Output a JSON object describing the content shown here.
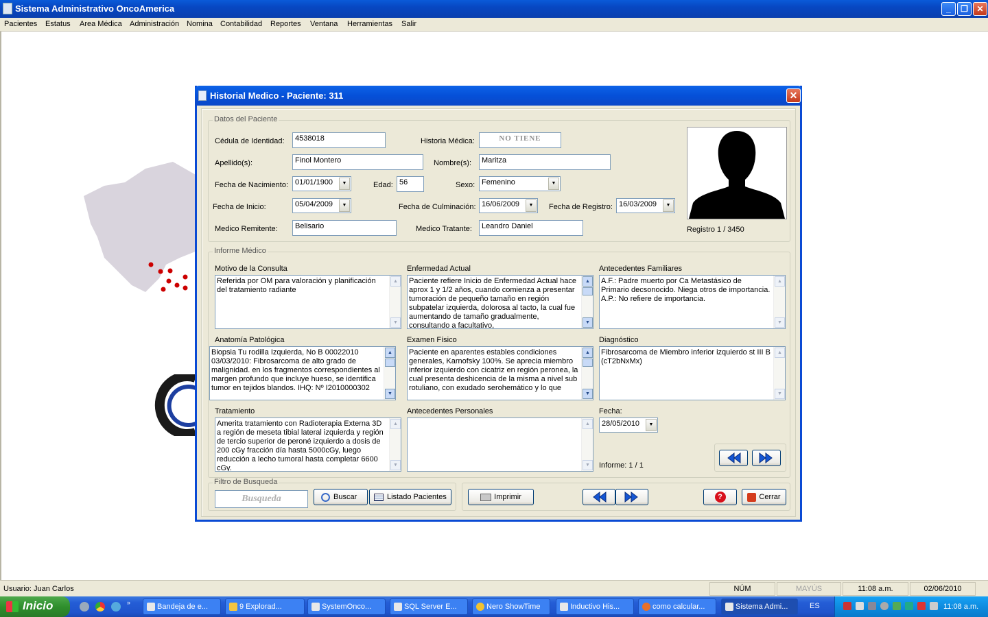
{
  "app": {
    "title": "Sistema Administrativo OncoAmerica"
  },
  "menu": [
    "Pacientes",
    "Estatus",
    "Area Médica",
    "Administración",
    "Nomina",
    "Contabilidad",
    "Reportes",
    "Ventana",
    "Herramientas",
    "Salir"
  ],
  "dialog": {
    "title": "Historial Medico - Paciente: 311",
    "datos": {
      "group_title": "Datos del Paciente",
      "cedula_label": "Cédula de Identidad:",
      "cedula": "4538018",
      "historia_label": "Historia Médica:",
      "historia": "NO TIENE",
      "apellido_label": "Apellido(s):",
      "apellido": "Finol Montero",
      "nombre_label": "Nombre(s):",
      "nombre": "Maritza",
      "fnac_label": "Fecha de Nacimiento:",
      "fnac": "01/01/1900",
      "edad_label": "Edad:",
      "edad": "56",
      "sexo_label": "Sexo:",
      "sexo": "Femenino",
      "finicio_label": "Fecha de Inicio:",
      "finicio": "05/04/2009",
      "fculm_label": "Fecha de Culminación:",
      "fculm": "16/06/2009",
      "freg_label": "Fecha de Registro:",
      "freg": "16/03/2009",
      "remitente_label": "Medico Remitente:",
      "remitente": "Belisario",
      "tratante_label": "Medico Tratante:",
      "tratante": "Leandro Daniel",
      "registro": "Registro 1 / 3450"
    },
    "informe": {
      "group_title": "Informe Médico",
      "motivo_label": "Motivo de la Consulta",
      "motivo": "Referida por OM para valoración y planificación del tratamiento radiante",
      "enfermedad_label": "Enfermedad Actual",
      "enfermedad": "Paciente refiere Inicio de Enfermedad Actual hace aprox 1 y 1/2 años, cuando comienza a presentar tumoración de pequeño tamaño en región subpatelar izquierda, dolorosa al tacto, la cual fue aumentando de tamaño gradualmente, consultando a facultativo,",
      "antfam_label": "Antecedentes Familiares",
      "antfam": "A.F.: Padre muerto por Ca Metastásico de Primario decsonocido. Niega otros de importancia. A.P.: No refiere de importancia.",
      "anatomia_label": "Anatomía Patológica",
      "anatomia": "Biopsia Tu rodilla Izquierda, No B 00022010 03/03/2010: Fibrosarcoma de alto grado de malignidad. en los fragmentos correspondientes al margen profundo que incluye hueso, se identifica tumor en tejidos blandos.  IHQ: Nº I2010000302",
      "examen_label": "Examen Físico",
      "examen": "Paciente en aparentes estables condiciones generales, Karnofsky 100%.  Se aprecia miembro inferior izquierdo con cicatriz en región peronea, la cual presenta deshicencia de la misma a nivel sub rotuliano, con exudado serohemático y lo que",
      "diagnostico_label": "Diagnóstico",
      "diagnostico": "Fibrosarcoma de Miembro inferior izquierdo st III B (cT2bNxMx)",
      "tratamiento_label": "Tratamiento",
      "tratamiento": "Amerita tratamiento con Radioterapia Externa 3D a región de meseta tibial lateral izquierda y región de tercio superior de peroné izquierdo a dosis de 200 cGy fracción día hasta 5000cGy, luego reducción a lecho tumoral hasta completar 6600 cGy.",
      "antper_label": "Antecedentes Personales",
      "antper": "",
      "fecha_label": "Fecha:",
      "fecha": "28/05/2010",
      "informe_count": "Informe: 1 / 1"
    },
    "filtro": {
      "group_title": "Filtro de Busqueda",
      "placeholder": "Busqueda",
      "buscar": "Buscar",
      "listado": "Listado Pacientes"
    },
    "buttons": {
      "imprimir": "Imprimir",
      "cerrar": "Cerrar"
    }
  },
  "status": {
    "usuario": "Usuario: Juan Carlos",
    "num": "NÚM",
    "mayus": "MAYÚS",
    "hora": "11:08 a.m.",
    "fecha": "02/06/2010"
  },
  "taskbar": {
    "start": "Inicio",
    "items": [
      "Bandeja de e...",
      "9 Explorad...",
      "SystemOnco...",
      "SQL Server E...",
      "Nero ShowTime",
      "Inductivo His...",
      "como calcular...",
      "Sistema Admi..."
    ],
    "lang": "ES",
    "clock": "11:08 a.m."
  }
}
